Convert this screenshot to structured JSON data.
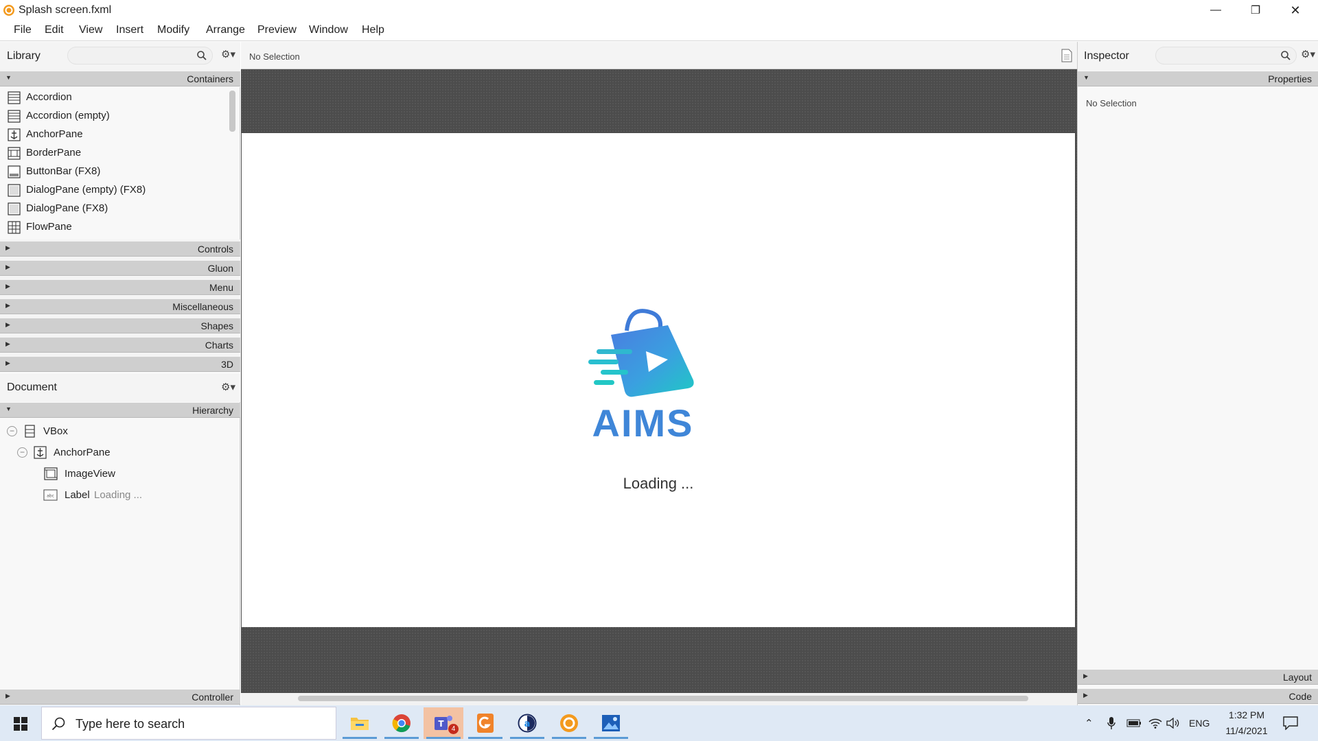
{
  "window": {
    "title": "Splash screen.fxml",
    "controls": {
      "minimize": "—",
      "maximize": "❐",
      "close": "✕"
    }
  },
  "menu": [
    "File",
    "Edit",
    "View",
    "Insert",
    "Modify",
    "Arrange",
    "Preview",
    "Window",
    "Help"
  ],
  "library": {
    "title": "Library",
    "sections": {
      "containers": "Containers",
      "controls": "Controls",
      "gluon": "Gluon",
      "menu": "Menu",
      "miscellaneous": "Miscellaneous",
      "shapes": "Shapes",
      "charts": "Charts",
      "threed": "3D"
    },
    "items": [
      {
        "label": "Accordion",
        "icon": "accordion-icon"
      },
      {
        "label": "Accordion  (empty)",
        "icon": "accordion-icon"
      },
      {
        "label": "AnchorPane",
        "icon": "anchorpane-icon"
      },
      {
        "label": "BorderPane",
        "icon": "borderpane-icon"
      },
      {
        "label": "ButtonBar  (FX8)",
        "icon": "buttonbar-icon"
      },
      {
        "label": "DialogPane (empty)  (FX8)",
        "icon": "dialogpane-icon"
      },
      {
        "label": "DialogPane  (FX8)",
        "icon": "dialogpane-icon"
      },
      {
        "label": "FlowPane",
        "icon": "flowpane-icon"
      }
    ]
  },
  "document": {
    "title": "Document",
    "hierarchy_label": "Hierarchy",
    "controller_label": "Controller",
    "tree": {
      "vbox": "VBox",
      "anchorpane": "AnchorPane",
      "imageview": "ImageView",
      "label": "Label",
      "label_text": "Loading ..."
    }
  },
  "canvas": {
    "selection": "No Selection",
    "logo_text": "AIMS",
    "loading_text": "Loading ..."
  },
  "inspector": {
    "title": "Inspector",
    "properties_label": "Properties",
    "no_selection": "No Selection",
    "layout_label": "Layout",
    "code_label": "Code"
  },
  "taskbar": {
    "search_placeholder": "Type here to search",
    "apps": [
      "file-explorer-icon",
      "chrome-icon",
      "teams-icon",
      "foxit-reader-icon",
      "browser-icon",
      "scene-builder-icon",
      "photos-icon"
    ],
    "teams_badge": "4",
    "language": "ENG",
    "time": "1:32 PM",
    "date": "11/4/2021"
  },
  "colors": {
    "accent": "#3aa0e0",
    "logo_text": "#3f86d8",
    "panel_header": "#cfcfcf",
    "taskbar": "#dfe9f5"
  }
}
